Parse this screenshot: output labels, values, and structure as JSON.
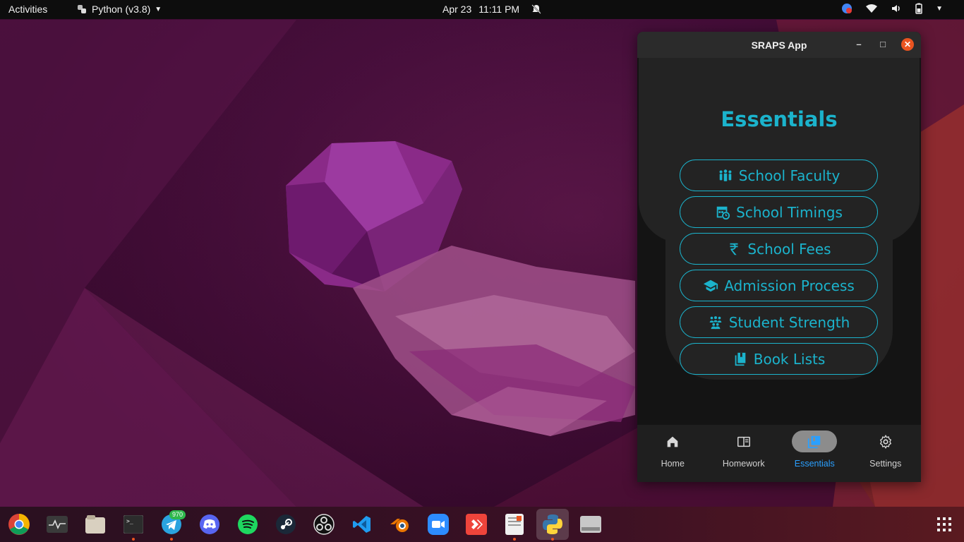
{
  "topbar": {
    "activities": "Activities",
    "app_name": "Python (v3.8)",
    "date": "Apr 23",
    "time": "11:11 PM"
  },
  "window": {
    "title": "SRAPS App",
    "minimize": "–",
    "maximize": "□",
    "close": "✕"
  },
  "essentials": {
    "heading": "Essentials",
    "buttons": [
      {
        "label": "School Faculty",
        "icon": "people-group-icon"
      },
      {
        "label": "School Timings",
        "icon": "calendar-clock-icon"
      },
      {
        "label": "School Fees",
        "icon": "rupee-icon"
      },
      {
        "label": "Admission Process",
        "icon": "graduation-cap-icon"
      },
      {
        "label": "Student Strength",
        "icon": "students-icon"
      },
      {
        "label": "Book Lists",
        "icon": "books-icon"
      }
    ]
  },
  "nav": {
    "items": [
      {
        "label": "Home",
        "icon": "home-icon"
      },
      {
        "label": "Homework",
        "icon": "book-open-icon"
      },
      {
        "label": "Essentials",
        "icon": "collections-icon"
      },
      {
        "label": "Settings",
        "icon": "gear-icon"
      }
    ],
    "active": "Essentials"
  },
  "dock": {
    "telegram_badge": "970",
    "apps": [
      "chrome",
      "system-monitor",
      "files",
      "terminal",
      "telegram",
      "discord",
      "spotify",
      "steam",
      "obs",
      "vscode",
      "blender",
      "zoom",
      "anydesk",
      "text-editor",
      "python",
      "disk"
    ]
  },
  "colors": {
    "accent": "#1bb3cc",
    "nav_active": "#2aa0ff",
    "close": "#e95420"
  }
}
